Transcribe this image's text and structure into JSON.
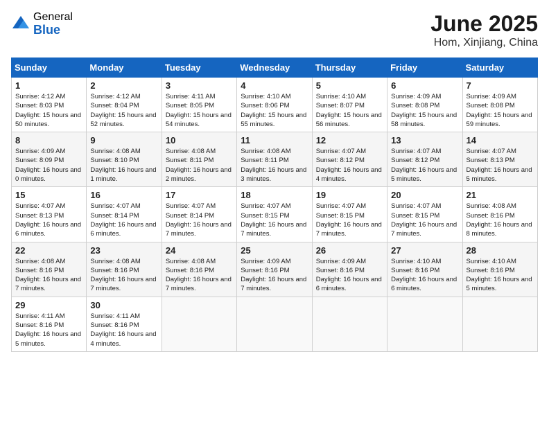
{
  "header": {
    "logo_general": "General",
    "logo_blue": "Blue",
    "month_title": "June 2025",
    "location": "Hom, Xinjiang, China"
  },
  "weekdays": [
    "Sunday",
    "Monday",
    "Tuesday",
    "Wednesday",
    "Thursday",
    "Friday",
    "Saturday"
  ],
  "weeks": [
    [
      {
        "day": "1",
        "sunrise": "4:12 AM",
        "sunset": "8:03 PM",
        "daylight": "15 hours and 50 minutes."
      },
      {
        "day": "2",
        "sunrise": "4:12 AM",
        "sunset": "8:04 PM",
        "daylight": "15 hours and 52 minutes."
      },
      {
        "day": "3",
        "sunrise": "4:11 AM",
        "sunset": "8:05 PM",
        "daylight": "15 hours and 54 minutes."
      },
      {
        "day": "4",
        "sunrise": "4:10 AM",
        "sunset": "8:06 PM",
        "daylight": "15 hours and 55 minutes."
      },
      {
        "day": "5",
        "sunrise": "4:10 AM",
        "sunset": "8:07 PM",
        "daylight": "15 hours and 56 minutes."
      },
      {
        "day": "6",
        "sunrise": "4:09 AM",
        "sunset": "8:08 PM",
        "daylight": "15 hours and 58 minutes."
      },
      {
        "day": "7",
        "sunrise": "4:09 AM",
        "sunset": "8:08 PM",
        "daylight": "15 hours and 59 minutes."
      }
    ],
    [
      {
        "day": "8",
        "sunrise": "4:09 AM",
        "sunset": "8:09 PM",
        "daylight": "16 hours and 0 minutes."
      },
      {
        "day": "9",
        "sunrise": "4:08 AM",
        "sunset": "8:10 PM",
        "daylight": "16 hours and 1 minute."
      },
      {
        "day": "10",
        "sunrise": "4:08 AM",
        "sunset": "8:11 PM",
        "daylight": "16 hours and 2 minutes."
      },
      {
        "day": "11",
        "sunrise": "4:08 AM",
        "sunset": "8:11 PM",
        "daylight": "16 hours and 3 minutes."
      },
      {
        "day": "12",
        "sunrise": "4:07 AM",
        "sunset": "8:12 PM",
        "daylight": "16 hours and 4 minutes."
      },
      {
        "day": "13",
        "sunrise": "4:07 AM",
        "sunset": "8:12 PM",
        "daylight": "16 hours and 5 minutes."
      },
      {
        "day": "14",
        "sunrise": "4:07 AM",
        "sunset": "8:13 PM",
        "daylight": "16 hours and 5 minutes."
      }
    ],
    [
      {
        "day": "15",
        "sunrise": "4:07 AM",
        "sunset": "8:13 PM",
        "daylight": "16 hours and 6 minutes."
      },
      {
        "day": "16",
        "sunrise": "4:07 AM",
        "sunset": "8:14 PM",
        "daylight": "16 hours and 6 minutes."
      },
      {
        "day": "17",
        "sunrise": "4:07 AM",
        "sunset": "8:14 PM",
        "daylight": "16 hours and 7 minutes."
      },
      {
        "day": "18",
        "sunrise": "4:07 AM",
        "sunset": "8:15 PM",
        "daylight": "16 hours and 7 minutes."
      },
      {
        "day": "19",
        "sunrise": "4:07 AM",
        "sunset": "8:15 PM",
        "daylight": "16 hours and 7 minutes."
      },
      {
        "day": "20",
        "sunrise": "4:07 AM",
        "sunset": "8:15 PM",
        "daylight": "16 hours and 7 minutes."
      },
      {
        "day": "21",
        "sunrise": "4:08 AM",
        "sunset": "8:16 PM",
        "daylight": "16 hours and 8 minutes."
      }
    ],
    [
      {
        "day": "22",
        "sunrise": "4:08 AM",
        "sunset": "8:16 PM",
        "daylight": "16 hours and 7 minutes."
      },
      {
        "day": "23",
        "sunrise": "4:08 AM",
        "sunset": "8:16 PM",
        "daylight": "16 hours and 7 minutes."
      },
      {
        "day": "24",
        "sunrise": "4:08 AM",
        "sunset": "8:16 PM",
        "daylight": "16 hours and 7 minutes."
      },
      {
        "day": "25",
        "sunrise": "4:09 AM",
        "sunset": "8:16 PM",
        "daylight": "16 hours and 7 minutes."
      },
      {
        "day": "26",
        "sunrise": "4:09 AM",
        "sunset": "8:16 PM",
        "daylight": "16 hours and 6 minutes."
      },
      {
        "day": "27",
        "sunrise": "4:10 AM",
        "sunset": "8:16 PM",
        "daylight": "16 hours and 6 minutes."
      },
      {
        "day": "28",
        "sunrise": "4:10 AM",
        "sunset": "8:16 PM",
        "daylight": "16 hours and 5 minutes."
      }
    ],
    [
      {
        "day": "29",
        "sunrise": "4:11 AM",
        "sunset": "8:16 PM",
        "daylight": "16 hours and 5 minutes."
      },
      {
        "day": "30",
        "sunrise": "4:11 AM",
        "sunset": "8:16 PM",
        "daylight": "16 hours and 4 minutes."
      },
      null,
      null,
      null,
      null,
      null
    ]
  ]
}
